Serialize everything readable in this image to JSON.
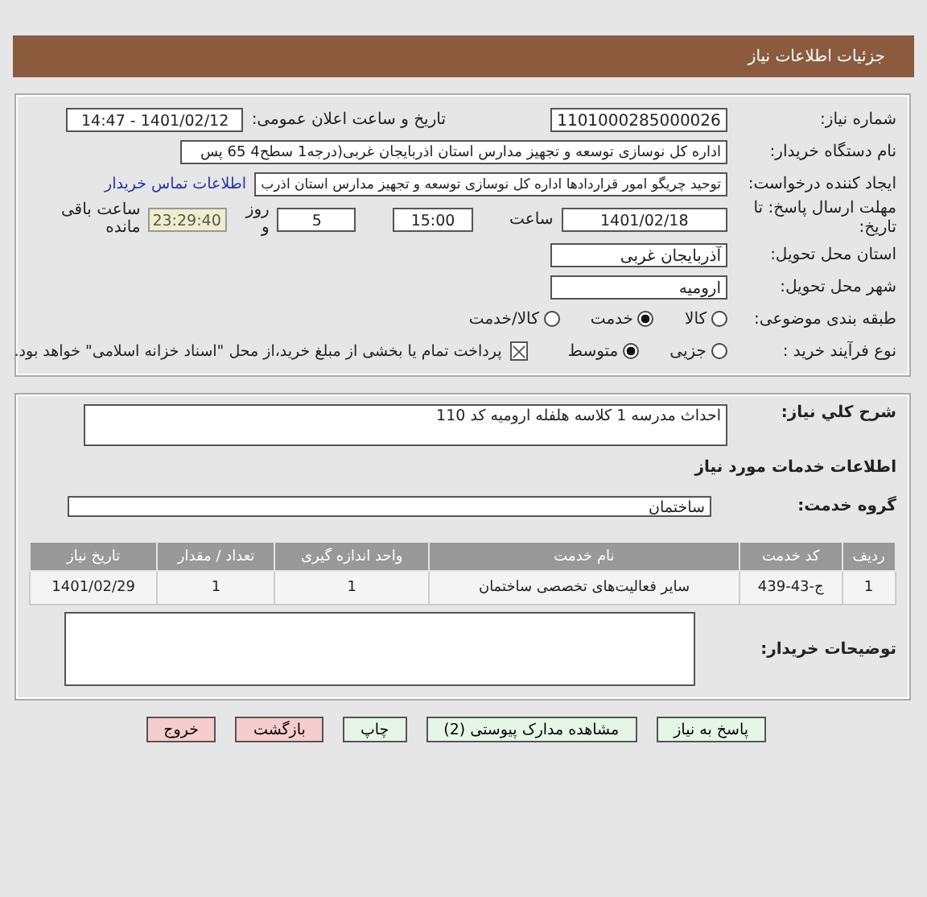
{
  "header": {
    "title": "جزئیات اطلاعات نیاز"
  },
  "details": {
    "need_number_label": "شماره نیاز:",
    "need_number": "1101000285000026",
    "announce_label": "تاریخ و ساعت اعلان عمومی:",
    "announce_value": "1401/02/12 - 14:47",
    "buyer_label": "نام دستگاه خریدار:",
    "buyer": "اداره کل نوسازی   توسعه و تجهیز مدارس استان اذربایجان غربی(درجه1  سطح4  65 پس",
    "creator_label": "ایجاد کننده درخواست:",
    "creator": "توحید چریگو امور قراردادها اداره کل نوسازی   توسعه و تجهیز مدارس استان اذرب",
    "contact_link": "اطلاعات تماس خریدار",
    "deadline_label": "مهلت ارسال پاسخ: تا تاریخ:",
    "deadline_date": "1401/02/18",
    "time_label": "ساعت",
    "deadline_time": "15:00",
    "days": "5",
    "days_label": "روز و",
    "remaining": "23:29:40",
    "remaining_label": "ساعت باقی مانده",
    "province_label": "استان محل تحویل:",
    "province": "آذربایجان غربی",
    "city_label": "شهر محل تحویل:",
    "city": "ارومیه",
    "category_label": "طبقه بندی موضوعی:",
    "categories": [
      {
        "label": "کالا",
        "selected": false
      },
      {
        "label": "خدمت",
        "selected": true
      },
      {
        "label": "کالا/خدمت",
        "selected": false
      }
    ],
    "process_label": "نوع فرآیند خرید :",
    "processes": [
      {
        "label": "جزیی",
        "selected": false
      },
      {
        "label": "متوسط",
        "selected": true
      }
    ],
    "payment": {
      "checked": true,
      "text": "پرداخت تمام یا بخشی از مبلغ خرید،از محل \"اسناد خزانه اسلامی\" خواهد بود."
    }
  },
  "need": {
    "summary_label": "شرح کلي نياز:",
    "summary": "احداث مدرسه 1 کلاسه هلفله ارومیه کد 110",
    "services_heading": "اطلاعات خدمات مورد نیاز",
    "group_label": "گروه خدمت:",
    "group": "ساختمان",
    "table": {
      "columns": [
        "ردیف",
        "کد خدمت",
        "نام خدمت",
        "واحد اندازه گیری",
        "تعداد / مقدار",
        "تاریخ نیاز"
      ],
      "rows": [
        [
          "1",
          "ج-43-439",
          "سایر فعالیت‌های تخصصی ساختمان",
          "1",
          "1",
          "1401/02/29"
        ]
      ]
    },
    "notes_label": "توضیحات خریدار:"
  },
  "buttons": [
    {
      "label": "پاسخ به نیاز",
      "kind": "green"
    },
    {
      "label": "مشاهده مدارک پیوستی (2)",
      "kind": "green"
    },
    {
      "label": "چاپ",
      "kind": "green"
    },
    {
      "label": "بازگشت",
      "kind": "red"
    },
    {
      "label": "خروج",
      "kind": "red"
    }
  ]
}
